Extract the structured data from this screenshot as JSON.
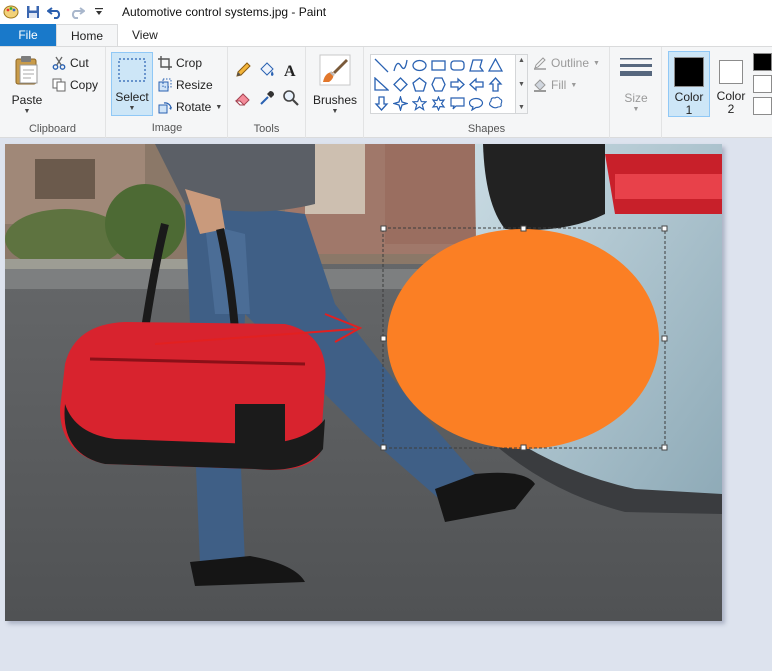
{
  "window": {
    "title": "Automotive control systems.jpg - Paint"
  },
  "tabs": {
    "file": "File",
    "home": "Home",
    "view": "View"
  },
  "clipboard": {
    "paste": "Paste",
    "cut": "Cut",
    "copy": "Copy",
    "label": "Clipboard"
  },
  "image": {
    "select": "Select",
    "crop": "Crop",
    "resize": "Resize",
    "rotate": "Rotate",
    "label": "Image"
  },
  "tools": {
    "label": "Tools"
  },
  "brushes": {
    "label": "Brushes"
  },
  "shapes": {
    "outline": "Outline",
    "fill": "Fill",
    "label": "Shapes"
  },
  "size": {
    "label": "Size"
  },
  "colors": {
    "color1_label": "Color",
    "color1_num": "1",
    "color2_label": "Color",
    "color2_num": "2",
    "color1_value": "#000000",
    "color2_value": "#ffffff",
    "accent": "#1979ca",
    "ellipse_fill": "#fb7f24",
    "arrow_color": "#e22020"
  }
}
